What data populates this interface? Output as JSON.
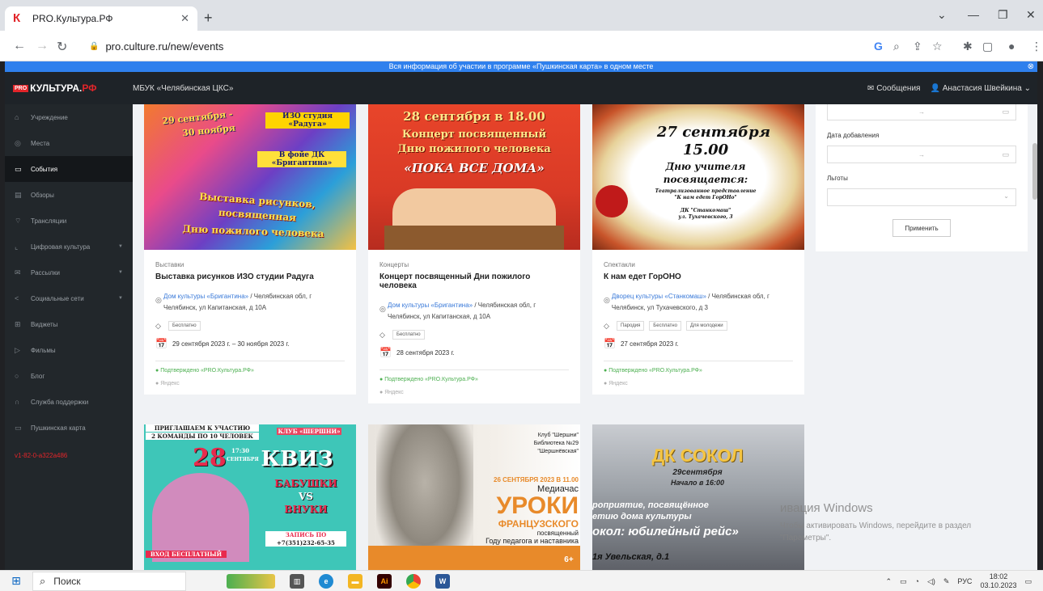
{
  "browser": {
    "tab_title": "PRO.Культура.РФ",
    "tab_favicon": "К",
    "url": "pro.culture.ru/new/events"
  },
  "banner": {
    "text": "Вся информация об участии в программе «Пушкинская карта» в одном месте"
  },
  "header": {
    "logo_pro": "PRO",
    "logo_main": "КУЛЬТУРА.",
    "logo_rf": "РФ",
    "organization": "МБУК «Челябинская ЦКС»",
    "messages": "Сообщения",
    "user": "Анастасия Швейкина"
  },
  "sidebar": {
    "items": [
      {
        "label": "Учреждение",
        "icon": "home-icon"
      },
      {
        "label": "Места",
        "icon": "location-icon"
      },
      {
        "label": "События",
        "icon": "calendar-icon"
      },
      {
        "label": "Обзоры",
        "icon": "document-icon"
      },
      {
        "label": "Трансляции",
        "icon": "broadcast-icon"
      },
      {
        "label": "Цифровая культура",
        "icon": "chart-icon"
      },
      {
        "label": "Рассылки",
        "icon": "mail-icon"
      },
      {
        "label": "Социальные сети",
        "icon": "share-icon"
      },
      {
        "label": "Виджеты",
        "icon": "widgets-icon"
      },
      {
        "label": "Фильмы",
        "icon": "film-icon"
      },
      {
        "label": "Блог",
        "icon": "blog-icon"
      },
      {
        "label": "Служба поддержки",
        "icon": "headset-icon"
      },
      {
        "label": "Пушкинская карта",
        "icon": "card-icon"
      }
    ],
    "version": "v1-82-0-a322a486"
  },
  "cards": [
    {
      "category": "Выставки",
      "title": "Выставка рисунков ИЗО студии Радуга",
      "place_link": "Дом культуры «Бригантина»",
      "address": "/ Челябинская обл, г Челябинск, ул Капитанская, д 10А",
      "tags": [
        "Бесплатно"
      ],
      "date": "29 сентября 2023 г. – 30 ноября 2023 г.",
      "confirmed": "Подтверждено «PRO.Культура.РФ»",
      "source": "Яндекс",
      "poster_lines": [
        "29 сентября -",
        "30 ноября",
        "ИЗО студия «Радуга»",
        "В фойе ДК «Бригантина»",
        "Выставка рисунков,",
        "посвященная",
        "Дню пожилого человека"
      ]
    },
    {
      "category": "Концерты",
      "title": "Концерт посвященный Дни пожилого человека",
      "place_link": "Дом культуры «Бригантина»",
      "address": "/ Челябинская обл, г Челябинск, ул Капитанская, д 10А",
      "tags": [
        "Бесплатно"
      ],
      "date": "28 сентября 2023 г.",
      "confirmed": "Подтверждено «PRO.Культура.РФ»",
      "source": "Яндекс",
      "poster_lines": [
        "28 сентября в 18.00",
        "Концерт посвященный",
        "Дню пожилого человека",
        "«ПОКА ВСЕ ДОМА»"
      ]
    },
    {
      "category": "Спектакли",
      "title": "К нам едет ГорОНО",
      "place_link": "Дворец культуры «Станкомаш»",
      "address": "/ Челябинская обл, г Челябинск, ул Тухачевского, д 3",
      "tags": [
        "Пародия",
        "Бесплатно",
        "Для молодежи"
      ],
      "date": "27 сентября 2023 г.",
      "confirmed": "Подтверждено «PRO.Культура.РФ»",
      "source": "Яндекс",
      "poster_lines": [
        "27 сентября",
        "15.00",
        "Дню учителя",
        "посвящается:",
        "Театрализованное представление",
        "\"К нам едет ГорОНо\"",
        "ДК \"Станкомаш\"",
        "ул. Тухачевского, 3"
      ]
    }
  ],
  "cards_row2": [
    {
      "poster_lines": [
        "ПРИГЛАШАЕМ К УЧАСТИЮ",
        "2 КОМАНДЫ ПО 10 ЧЕЛОВЕК",
        "КЛУБ «ШЕРШНИ»",
        "28",
        "17:30",
        "СЕНТЯБРЯ",
        "КВИЗ",
        "БАБУШКИ",
        "VS",
        "ВНУКИ",
        "ВХОД БЕСПЛАТНЫЙ",
        "ЗАПИСЬ ПО ТЕЛЕФОНУ:",
        "+7(351)232-65-35"
      ]
    },
    {
      "poster_lines": [
        "Клуб \"Шершни\"",
        "Библиотека №29",
        "\"Шершнёвская\"",
        "26 СЕНТЯБРЯ 2023 В 11.00",
        "Медиачас",
        "УРОКИ",
        "ФРАНЦУЗСКОГО",
        "посвященный",
        "Году педагога и наставника",
        "6+"
      ]
    },
    {
      "poster_lines": [
        "ДК СОКОЛ",
        "29сентября",
        "Начало в 16:00",
        "роприятие, посвящённое",
        "етию дома культуры",
        "окол: юбилейный рейс»",
        "1я Увельская, д.1"
      ]
    }
  ],
  "filters": {
    "date_range_sep": "→",
    "added_label": "Дата добавления",
    "benefits_label": "Льготы",
    "apply": "Применить"
  },
  "watermark": {
    "title": "ивация Windows",
    "text": "Чтобы активировать Windows, перейдите в раздел \"Параметры\"."
  },
  "taskbar": {
    "search": "Поиск",
    "lang": "РУС",
    "time": "18:02",
    "date": "03.10.2023"
  }
}
